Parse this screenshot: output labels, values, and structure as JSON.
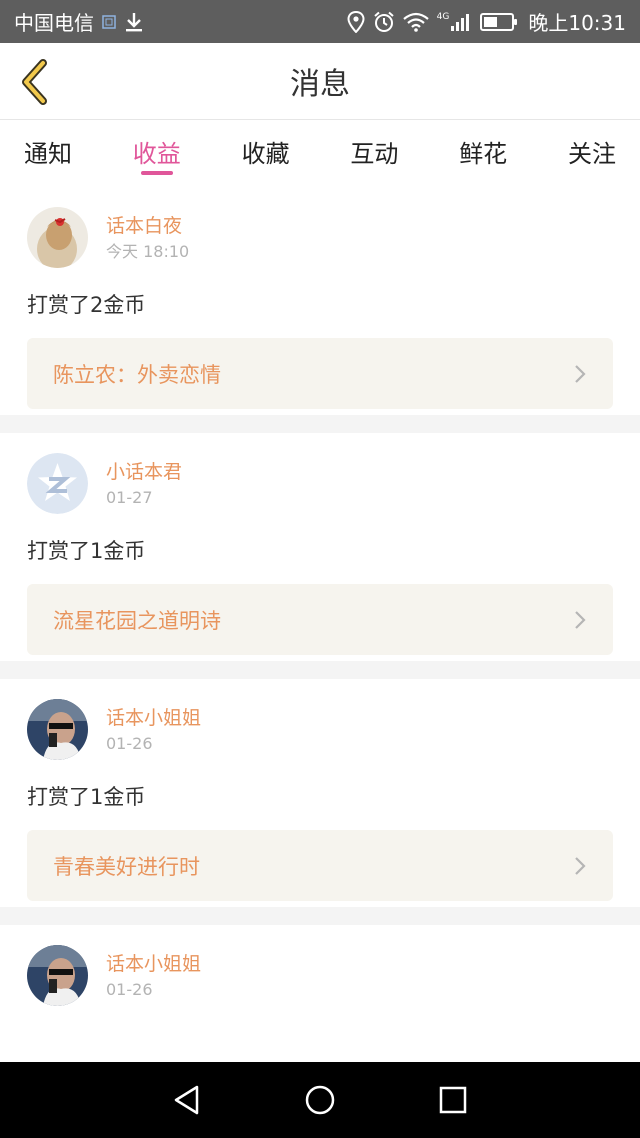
{
  "status_bar": {
    "carrier": "中国电信",
    "time": "晚上10:31",
    "network": "4G",
    "battery_level": 0.5,
    "icons": [
      "sim-icon",
      "download-icon",
      "location-icon",
      "alarm-icon",
      "wifi-icon",
      "signal-icon",
      "battery-icon"
    ]
  },
  "header": {
    "title": "消息",
    "back_icon": "chevron-left-icon"
  },
  "tabs": [
    {
      "label": "通知",
      "active": false
    },
    {
      "label": "收益",
      "active": true
    },
    {
      "label": "收藏",
      "active": false
    },
    {
      "label": "互动",
      "active": false
    },
    {
      "label": "鲜花",
      "active": false
    },
    {
      "label": "关注",
      "active": false
    }
  ],
  "feed": [
    {
      "name": "话本白夜",
      "time": "今天 18:10",
      "action": "打赏了2金币",
      "book": "陈立农：外卖恋情"
    },
    {
      "name": "小话本君",
      "time": "01-27",
      "action": "打赏了1金币",
      "book": "流星花园之道明诗"
    },
    {
      "name": "话本小姐姐",
      "time": "01-26",
      "action": "打赏了1金币",
      "book": "青春美好进行时"
    },
    {
      "name": "话本小姐姐",
      "time": "01-26",
      "action": "",
      "book": ""
    }
  ],
  "colors": {
    "accent": "#e0569a",
    "name": "#e8955e",
    "card_bg": "#f6f4ee"
  }
}
